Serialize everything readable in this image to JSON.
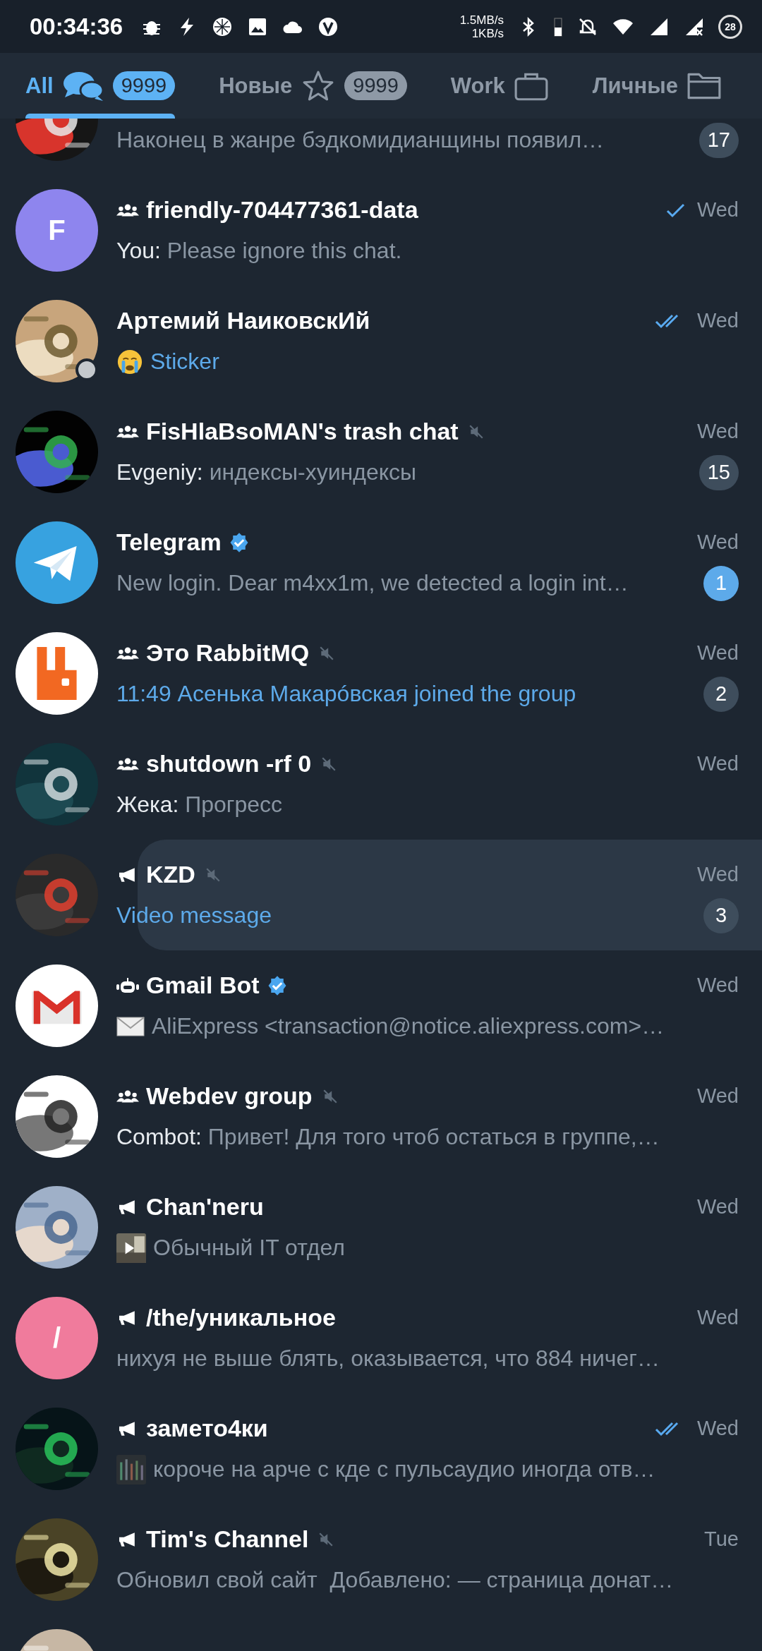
{
  "status_bar": {
    "time": "00:34:36",
    "net_up": "1.5MB/s",
    "net_down": "1KB/s",
    "battery": "28"
  },
  "tabs": [
    {
      "label": "All",
      "badge": "9999",
      "selected": true
    },
    {
      "label": "Новые",
      "badge": "9999",
      "selected": false
    },
    {
      "label": "Work",
      "selected": false
    },
    {
      "label": "Личные",
      "selected": false
    }
  ],
  "chats": [
    {
      "kind": "partial_top",
      "message": "Наконец в жанре бэдкомидианщины появил…",
      "badge": "17",
      "badge_muted": true
    },
    {
      "kind": "group",
      "name": "friendly-704477361-data",
      "verified": false,
      "muted": false,
      "highlighted": false,
      "status_dot": false,
      "avatar": {
        "kind": "letter",
        "letter": "F",
        "color": "#8e85ee"
      },
      "outgoing": true,
      "read": false,
      "time": "Wed",
      "sender": "You:",
      "message": "Please ignore this chat.",
      "media_text": false
    },
    {
      "kind": "person",
      "name": "Артемий НаиковскИй",
      "verified": false,
      "muted": false,
      "highlighted": false,
      "status_dot": true,
      "outgoing": true,
      "read": true,
      "time": "Wed",
      "attachment": {
        "kind": "sticker"
      },
      "message": "Sticker",
      "media_text": true
    },
    {
      "kind": "group",
      "name": "FisHlaBsoMAN's trash chat",
      "verified": false,
      "muted": true,
      "highlighted": false,
      "status_dot": false,
      "outgoing": false,
      "time": "Wed",
      "sender": "Evgeniy:",
      "message": "индексы-хуиндексы",
      "media_text": false,
      "badge": "15",
      "badge_muted": true
    },
    {
      "kind": "person",
      "name": "Telegram",
      "verified": true,
      "muted": false,
      "highlighted": false,
      "status_dot": false,
      "avatar": {
        "kind": "logo"
      },
      "outgoing": false,
      "time": "Wed",
      "message": "New login. Dear m4xx1m, we detected a login int…",
      "media_text": false,
      "badge": "1",
      "badge_muted": false
    },
    {
      "kind": "group",
      "name": "Это RabbitMQ",
      "verified": false,
      "muted": true,
      "highlighted": false,
      "status_dot": false,
      "avatar": {
        "kind": "logo"
      },
      "outgoing": false,
      "time": "Wed",
      "message": "11:49 Асенька Макарóвская joined the group",
      "media_text": true,
      "badge": "2",
      "badge_muted": true
    },
    {
      "kind": "group",
      "name": "shutdown -rf 0",
      "verified": false,
      "muted": true,
      "highlighted": false,
      "status_dot": false,
      "outgoing": false,
      "time": "Wed",
      "sender": "Жека:",
      "message": "Прогресс",
      "media_text": false
    },
    {
      "kind": "channel",
      "name": "KZD",
      "verified": false,
      "muted": true,
      "highlighted": true,
      "status_dot": false,
      "outgoing": false,
      "time": "Wed",
      "message": "Video message",
      "media_text": true,
      "badge": "3",
      "badge_muted": true
    },
    {
      "kind": "bot",
      "name": "Gmail Bot",
      "verified": true,
      "muted": false,
      "highlighted": false,
      "status_dot": false,
      "avatar": {
        "kind": "logo"
      },
      "outgoing": false,
      "time": "Wed",
      "attachment": {
        "kind": "email"
      },
      "message": "AliExpress <transaction@notice.aliexpress.com>…",
      "media_text": false
    },
    {
      "kind": "group",
      "name": "Webdev group",
      "verified": false,
      "muted": true,
      "highlighted": false,
      "status_dot": false,
      "outgoing": false,
      "time": "Wed",
      "sender": "Combot:",
      "message": "Привет! Для того чтоб остаться в группе,…",
      "media_text": false
    },
    {
      "kind": "channel",
      "name": "Chan'neru",
      "verified": false,
      "muted": false,
      "highlighted": false,
      "status_dot": false,
      "outgoing": false,
      "time": "Wed",
      "attachment": {
        "kind": "video"
      },
      "message": "Обычный IT отдел",
      "media_text": false
    },
    {
      "kind": "channel",
      "name": "/the/уникальное",
      "verified": false,
      "muted": false,
      "highlighted": false,
      "status_dot": false,
      "avatar": {
        "kind": "letter",
        "letter": "/",
        "color": "#f07b9c"
      },
      "outgoing": false,
      "time": "Wed",
      "message": "нихуя не выше блять, оказывается, что 884 ничег…",
      "media_text": false
    },
    {
      "kind": "channel",
      "name": "замето4ки",
      "verified": false,
      "muted": false,
      "highlighted": false,
      "status_dot": false,
      "outgoing": true,
      "read": true,
      "time": "Wed",
      "message": "короче на арче с кде с пульсаудио иногда отв…",
      "media_text": false
    },
    {
      "kind": "channel",
      "name": "Tim's Channel",
      "verified": false,
      "muted": true,
      "highlighted": false,
      "status_dot": false,
      "outgoing": false,
      "time": "Tue",
      "message": "Обновил свой сайт  Добавлено: — страница донат…",
      "media_text": false
    },
    {
      "kind": "partial_bottom"
    }
  ]
}
